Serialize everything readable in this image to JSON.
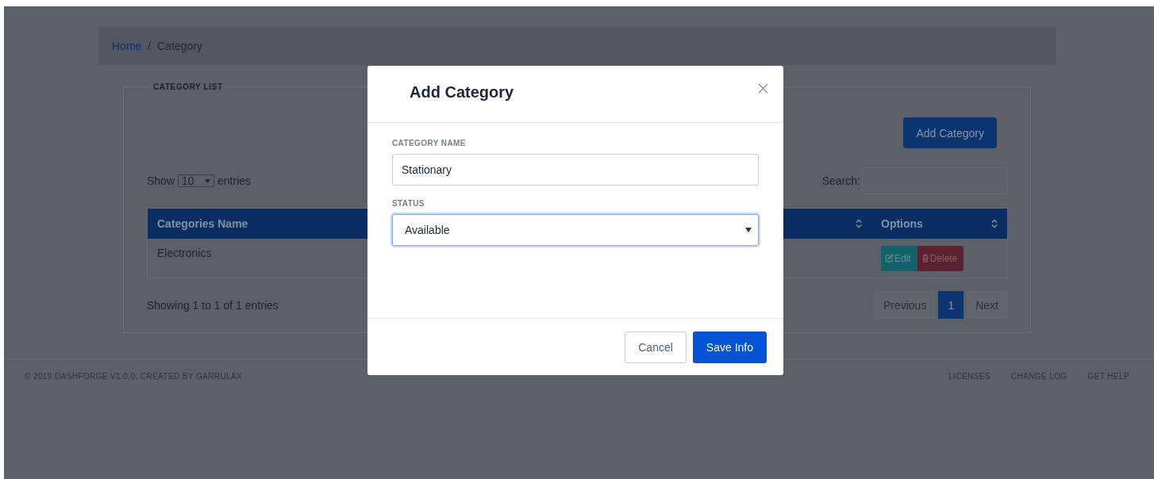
{
  "breadcrumb_separator": "/",
  "breadcrumb": [
    {
      "label": "Home",
      "kind": "link"
    },
    {
      "label": "Category",
      "kind": "current"
    }
  ],
  "panel": {
    "legend": "CATEGORY LIST",
    "add_button": "Add Category",
    "length": {
      "prefix": "Show",
      "value": "10",
      "suffix": "entries"
    },
    "search": {
      "label": "Search:"
    },
    "table": {
      "columns": [
        "Categories Name",
        "Options"
      ],
      "rows": [
        {
          "name": "Electronics",
          "actions": [
            {
              "label": "Edit",
              "kind": "edit"
            },
            {
              "label": "Delete",
              "kind": "delete"
            }
          ]
        }
      ]
    },
    "info": "Showing 1 to 1 of 1 entries",
    "pagination": [
      {
        "label": "Previous",
        "selected": false
      },
      {
        "label": "1",
        "selected": true
      },
      {
        "label": "Next",
        "selected": false
      }
    ]
  },
  "footer": {
    "copyright": "© 2019 DASHFORGE V1.0.0. CREATED BY GARRULAX",
    "links": [
      "LICENSES",
      "CHANGE LOG",
      "GET HELP"
    ]
  },
  "modal": {
    "title": "Add Category",
    "fields": [
      {
        "label": "CATEGORY NAME",
        "kind": "text",
        "value": "Stationary",
        "focused": false
      },
      {
        "label": "STATUS",
        "kind": "select",
        "value": "Available",
        "focused": true
      }
    ],
    "buttons": [
      {
        "label": "Cancel",
        "kind": "secondary"
      },
      {
        "label": "Save Info",
        "kind": "primary"
      }
    ]
  }
}
